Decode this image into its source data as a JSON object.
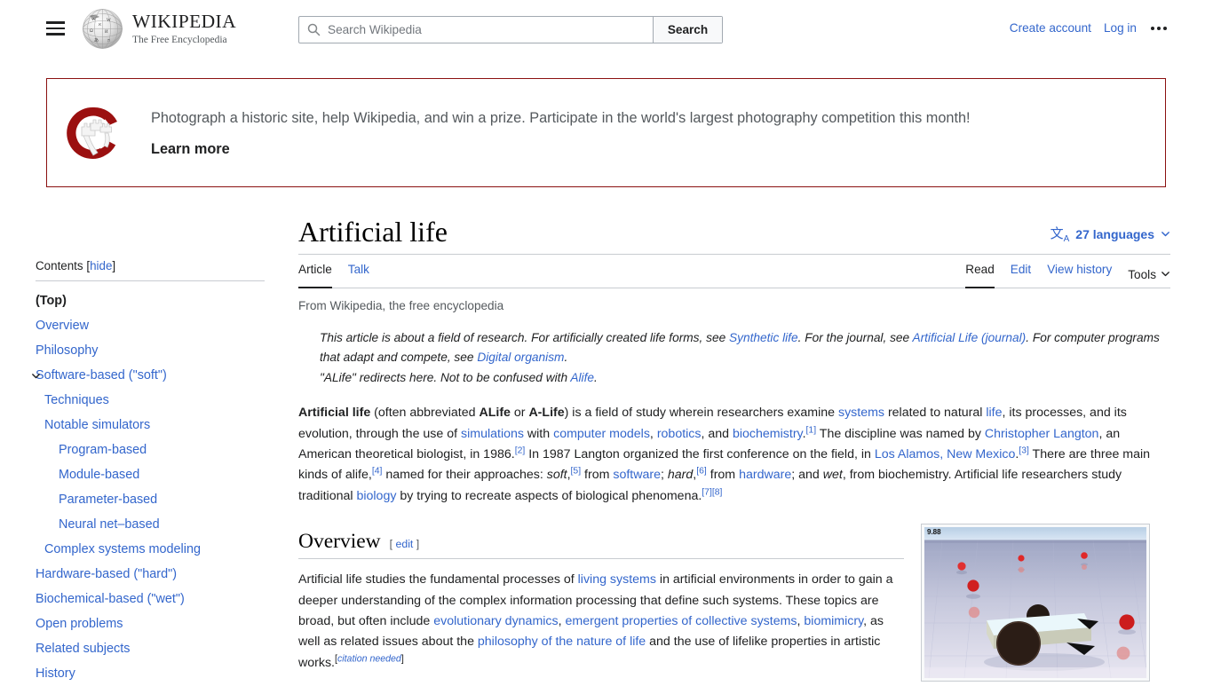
{
  "header": {
    "menu_icon": "hamburger-icon",
    "logo_wordmark": "WIKIPEDIA",
    "logo_tagline": "The Free Encyclopedia",
    "search": {
      "icon": "search-icon",
      "placeholder": "Search Wikipedia",
      "value": "",
      "button_label": "Search"
    },
    "create_account": "Create account",
    "log_in": "Log in",
    "more_icon": "ellipsis-icon"
  },
  "banner": {
    "logo_icon": "wiki-loves-monuments-logo",
    "text": "Photograph a historic site, help Wikipedia, and win a prize. Participate in the world's largest photography competition this month!",
    "cta": "Learn more",
    "border_color": "#8b1111"
  },
  "toc": {
    "title": "Contents",
    "bracket_open": "[",
    "hide_label": "hide",
    "bracket_close": "]",
    "items": [
      {
        "label": "(Top)",
        "level": 0,
        "active": true
      },
      {
        "label": "Overview",
        "level": 0
      },
      {
        "label": "Philosophy",
        "level": 0
      },
      {
        "label": "Software-based (\"soft\")",
        "level": 0,
        "expandable": true
      },
      {
        "label": "Techniques",
        "level": 1
      },
      {
        "label": "Notable simulators",
        "level": 1
      },
      {
        "label": "Program-based",
        "level": 2
      },
      {
        "label": "Module-based",
        "level": 2
      },
      {
        "label": "Parameter-based",
        "level": 2
      },
      {
        "label": "Neural net–based",
        "level": 2
      },
      {
        "label": "Complex systems modeling",
        "level": 1
      },
      {
        "label": "Hardware-based (\"hard\")",
        "level": 0
      },
      {
        "label": "Biochemical-based (\"wet\")",
        "level": 0
      },
      {
        "label": "Open problems",
        "level": 0
      },
      {
        "label": "Related subjects",
        "level": 0
      },
      {
        "label": "History",
        "level": 0
      }
    ]
  },
  "article": {
    "title": "Artificial life",
    "languages": {
      "icon": "translate-icon",
      "label": "27 languages",
      "chevron": "chevron-down-icon"
    },
    "namespace_tabs": [
      {
        "label": "Article",
        "active": true
      },
      {
        "label": "Talk",
        "active": false
      }
    ],
    "view_tabs": [
      {
        "label": "Read",
        "active": true
      },
      {
        "label": "Edit",
        "active": false
      },
      {
        "label": "View history",
        "active": false
      }
    ],
    "tools_label": "Tools",
    "siteSub": "From Wikipedia, the free encyclopedia",
    "hatnotes": {
      "line1_a": "This article is about a field of research. For artificially created life forms, see ",
      "line1_link1": "Synthetic life",
      "line1_b": ". For the journal, see ",
      "line1_link2": "Artificial Life (journal)",
      "line1_c": ". For computer programs that adapt and compete, see ",
      "line1_link3": "Digital organism",
      "line1_d": ".",
      "line2_a": "\"ALife\" redirects here. Not to be confused with ",
      "line2_link": "Alife",
      "line2_b": "."
    },
    "lead": {
      "t1": "Artificial life",
      "t2": " (often abbreviated ",
      "t3": "ALife",
      "t4": " or ",
      "t5": "A-Life",
      "t6": ") is a field of study wherein researchers examine ",
      "l_systems": "systems",
      "t7": " related to natural ",
      "l_life": "life",
      "t8": ", its processes, and its evolution, through the use of ",
      "l_simulations": "simulations",
      "t9": " with ",
      "l_computer_models": "computer models",
      "t10": ", ",
      "l_robotics": "robotics",
      "t11": ", and ",
      "l_biochemistry": "biochemistry",
      "t12": ".",
      "ref1": "[1]",
      "t13": " The discipline was named by ",
      "l_langton": "Christopher Langton",
      "t14": ", an American theoretical biologist, in 1986.",
      "ref2": "[2]",
      "t15": " In 1987 Langton organized the first conference on the field, in ",
      "l_losalamos": "Los Alamos, New Mexico",
      "t16": ".",
      "ref3": "[3]",
      "t17": " There are three main kinds of alife,",
      "ref4": "[4]",
      "t18": " named for their approaches: ",
      "i_soft": "soft",
      "t19": ",",
      "ref5": "[5]",
      "t20": " from ",
      "l_software": "software",
      "t21": "; ",
      "i_hard": "hard",
      "t22": ",",
      "ref6": "[6]",
      "t23": " from ",
      "l_hardware": "hardware",
      "t24": "; and ",
      "i_wet": "wet",
      "t25": ", from biochemistry. Artificial life researchers study traditional ",
      "l_biology": "biology",
      "t26": " by trying to recreate aspects of biological phenomena.",
      "ref7": "[7]",
      "ref8": "[8]"
    },
    "overview": {
      "heading": "Overview",
      "edit_open": "[",
      "edit_label": "edit",
      "edit_close": "]",
      "p1": "Artificial life studies the fundamental processes of ",
      "l_living_systems": "living systems",
      "p2": " in artificial environments in order to gain a deeper understanding of the complex information processing that define such systems. These topics are broad, but often include ",
      "l_evo_dynamics": "evolutionary dynamics",
      "p3": ", ",
      "l_emergent": "emergent properties of collective systems",
      "p4": ", ",
      "l_biomimicry": "biomimicry",
      "p5": ", as well as related issues about the ",
      "l_philosophy": "philosophy of the nature of life",
      "p6": " and the use of lifelike properties in artistic works.",
      "cn_open": "[",
      "cn_label": "citation needed",
      "cn_close": "]"
    },
    "thumbnail": {
      "name": "alife-simulation-thumbnail",
      "counter": "9.88"
    }
  },
  "colors": {
    "link": "#3366cc",
    "text": "#202122",
    "muted": "#54595d",
    "rule": "#c8ccd1",
    "banner_border": "#8b1111"
  }
}
